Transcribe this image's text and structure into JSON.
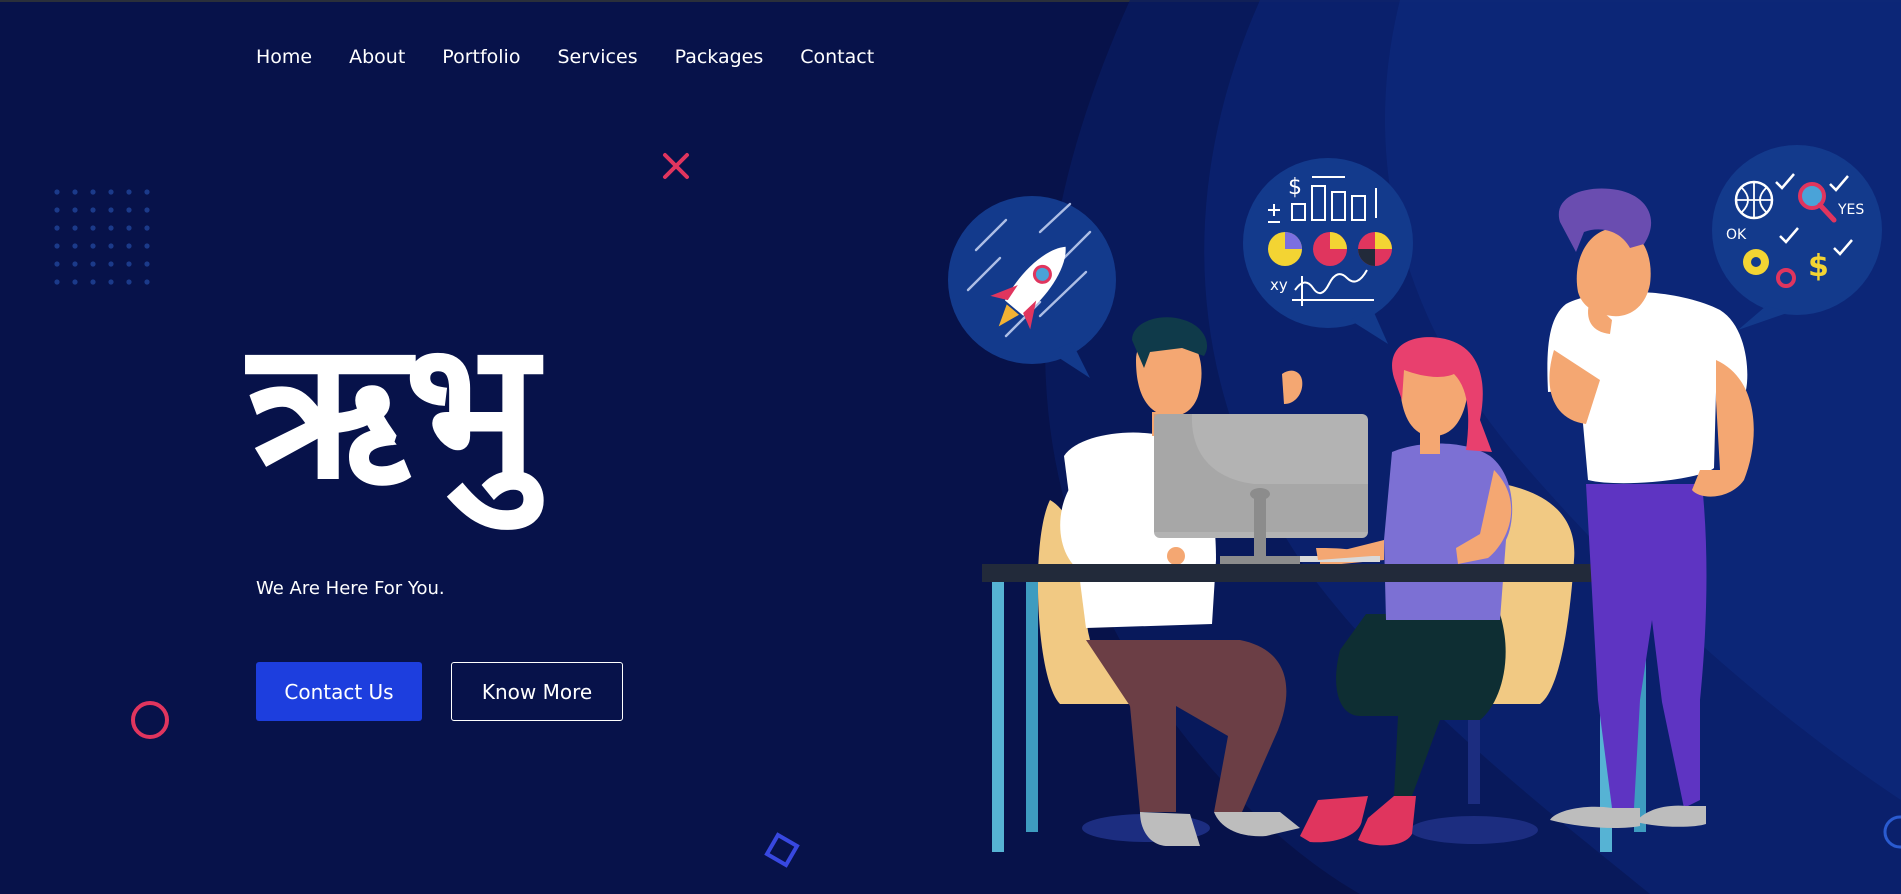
{
  "nav": {
    "items": [
      {
        "label": "Home"
      },
      {
        "label": "About"
      },
      {
        "label": "Portfolio"
      },
      {
        "label": "Services"
      },
      {
        "label": "Packages"
      },
      {
        "label": "Contact"
      }
    ]
  },
  "hero": {
    "title": "ऋभु",
    "tagline": "We Are Here For You.",
    "primary_button": "Contact Us",
    "secondary_button": "Know More"
  },
  "illustration": {
    "bubble_labels": {
      "ok": "OK",
      "yes": "YES",
      "xy": "xy",
      "dollar": "$"
    }
  },
  "colors": {
    "background": "#07124a",
    "accent_blue": "#1d3ede",
    "accent_pink": "#e0355e",
    "deco_blue": "#3848e0"
  }
}
